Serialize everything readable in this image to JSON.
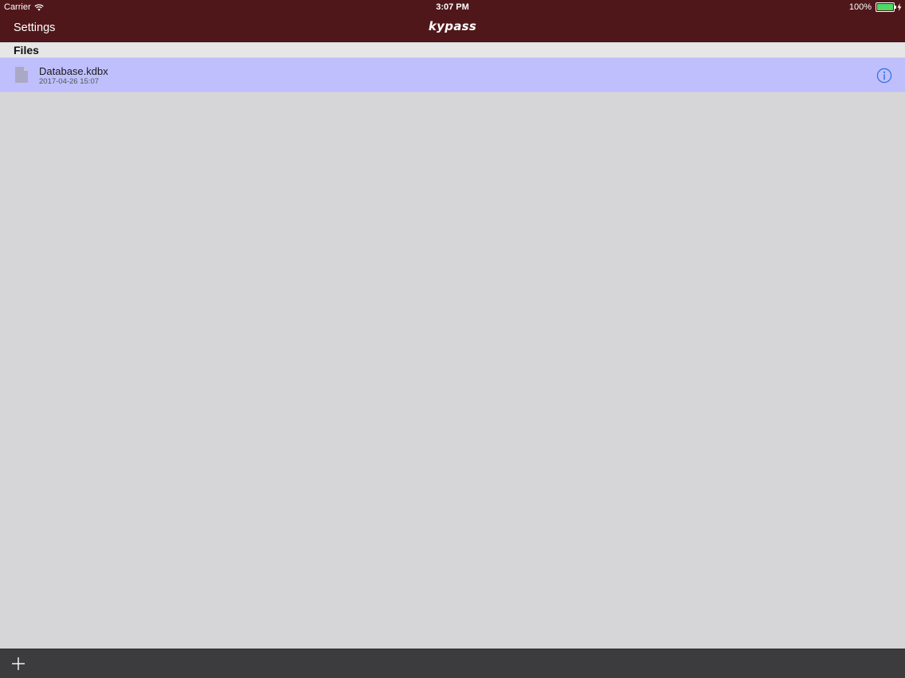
{
  "status_bar": {
    "carrier": "Carrier",
    "time": "3:07 PM",
    "battery_percent": "100%",
    "battery_level": 1.0,
    "battery_color": "#4cd964"
  },
  "nav_bar": {
    "left_button": "Settings",
    "logo_text": "kypass",
    "background_color": "#50171a"
  },
  "files_section": {
    "title": "Files",
    "items": [
      {
        "name": "Database.kdbx",
        "date": "2017-04-26 15:07",
        "selected": true,
        "icon": "document-icon",
        "accessory_icon": "info-icon"
      }
    ],
    "selected_row_color": "#bfbffd"
  },
  "toolbar": {
    "add_icon": "plus-icon"
  }
}
